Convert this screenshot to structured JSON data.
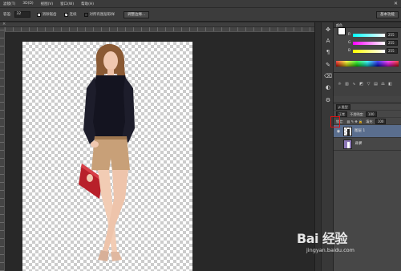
{
  "menubar": {
    "items": [
      "滤镜(T)",
      "3D(D)",
      "视图(V)",
      "窗口(W)",
      "帮助(H)"
    ],
    "close_glyph": "✕"
  },
  "options_bar": {
    "feather_label": "容差:",
    "feather_value": "32",
    "anti_alias_label": "消除锯齿",
    "contiguous_label": "连续",
    "sample_all_label": "对所有图层取样",
    "refine_edge_button": "调整边缘...",
    "workspace_button": "基本功能"
  },
  "tools": [
    "move-icon",
    "type-icon",
    "ab-icon",
    "brush-icon",
    "eraser-icon",
    "adjust-icon",
    "gear-icon"
  ],
  "color_panel": {
    "tab": "颜色",
    "rows": [
      {
        "label": "R",
        "value": "255"
      },
      {
        "label": "G",
        "value": "255"
      },
      {
        "label": "B",
        "value": "255"
      }
    ]
  },
  "layers_panel": {
    "filter_label": "ρ 类型",
    "blend_mode": "正常",
    "opacity_label": "不透明度:",
    "opacity_value": "100",
    "lock_label": "锁定:",
    "fill_label": "填充:",
    "fill_value": "100",
    "layers": [
      {
        "name": "图层 1",
        "visible": true,
        "active": true
      },
      {
        "name": "背景",
        "visible": false,
        "active": false
      }
    ]
  },
  "watermark": {
    "brand": "Bai  经验",
    "url": "jingyan.baidu.com"
  },
  "colors": {
    "accent_red": "#e01010",
    "layer_selected": "#5a6e8e"
  }
}
